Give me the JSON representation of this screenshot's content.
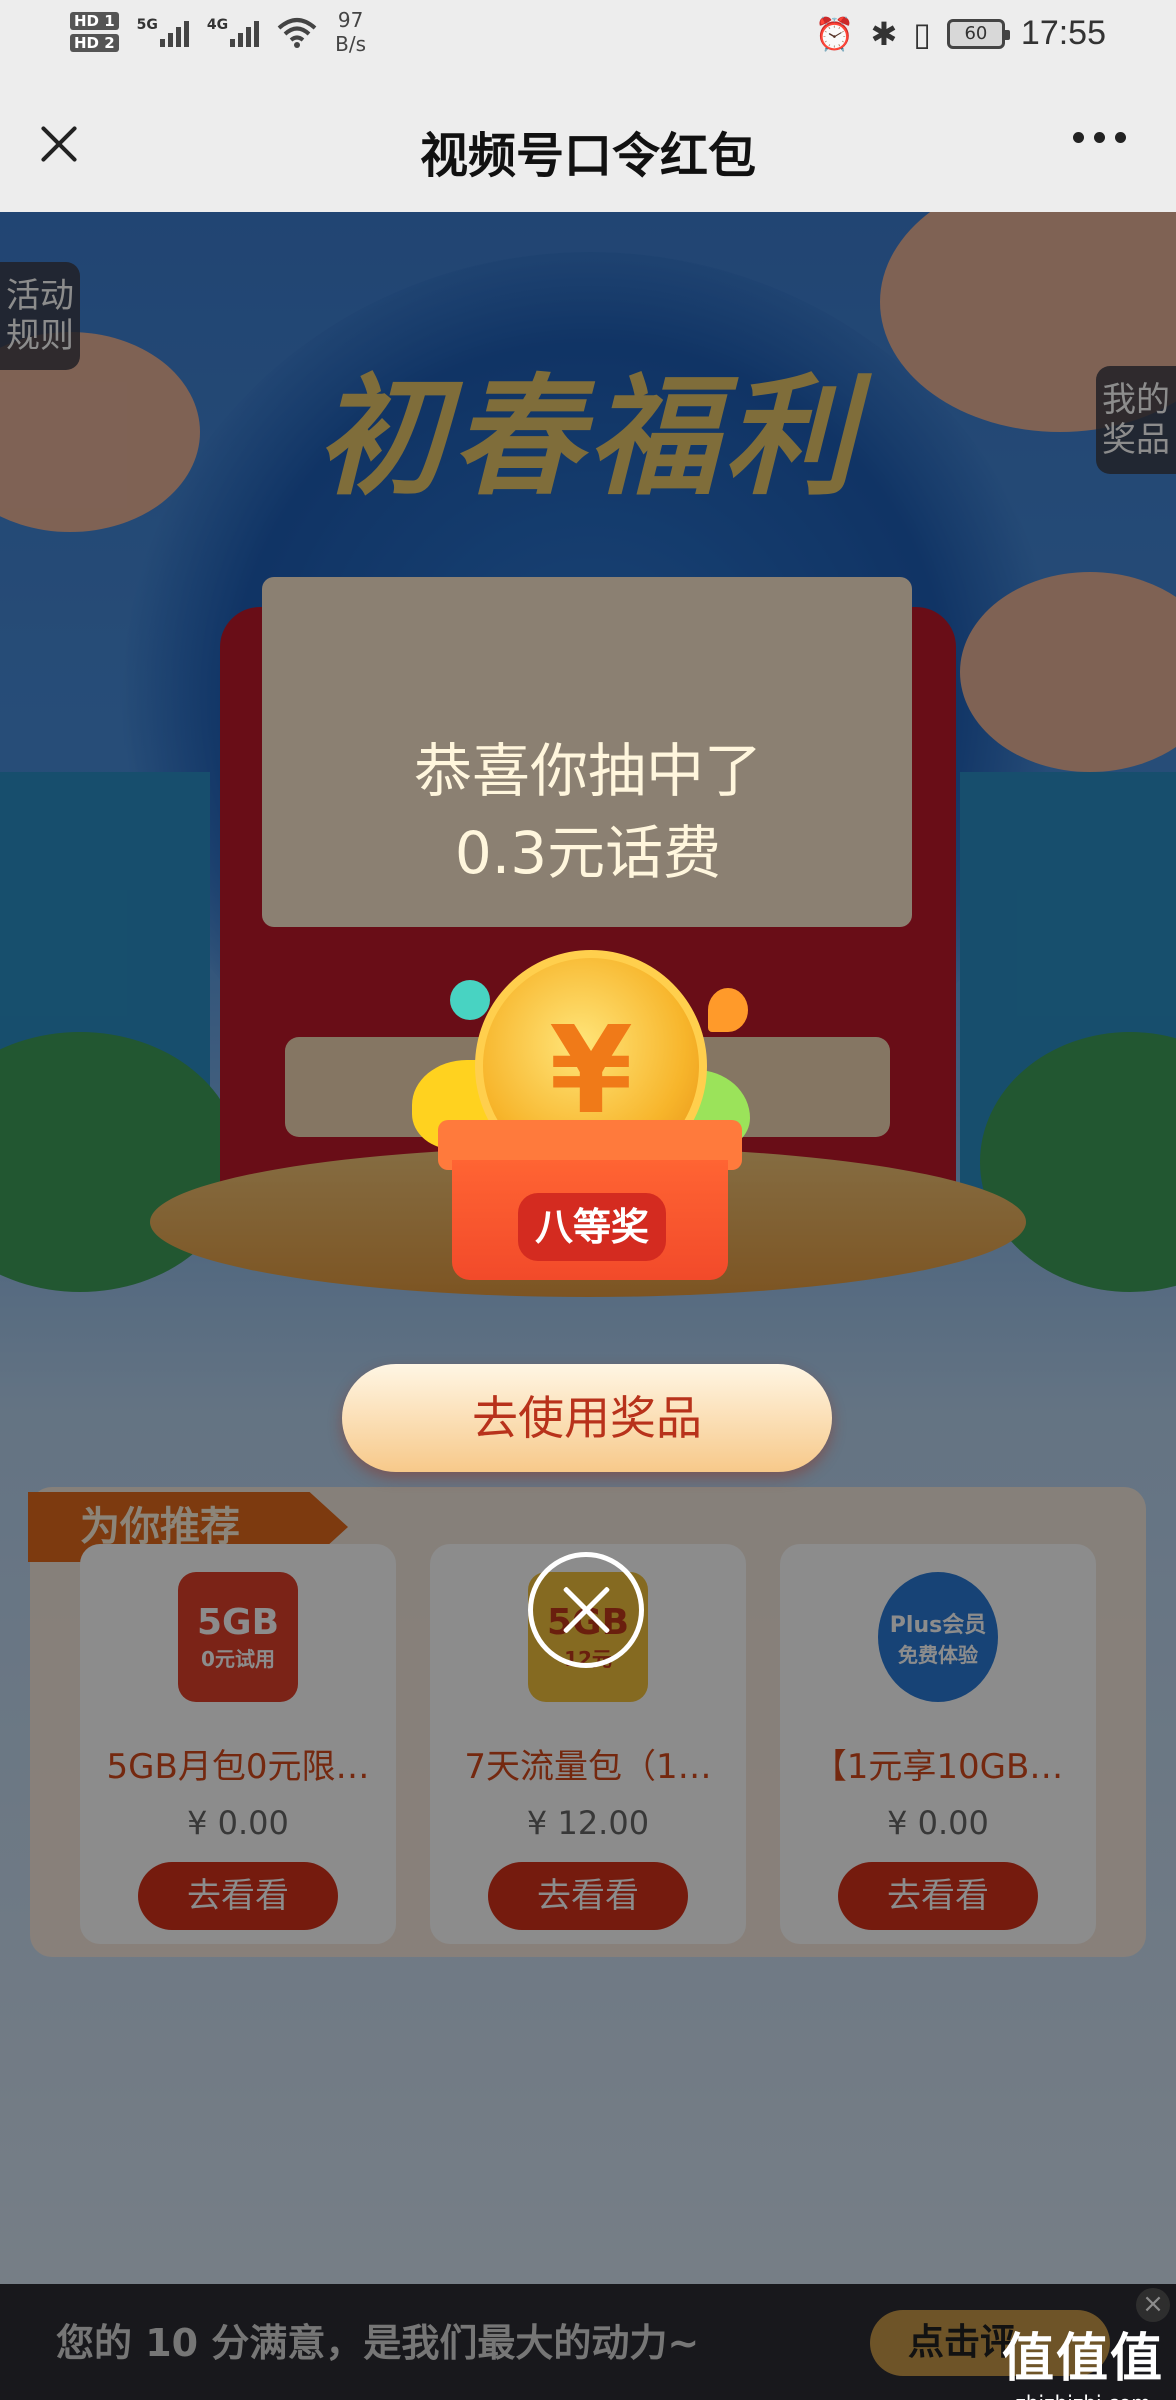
{
  "status_bar": {
    "hd1": "HD 1",
    "hd2": "HD 2",
    "net1": "5G",
    "net2": "4G",
    "speed_value": "97",
    "speed_unit": "B/s",
    "battery": "60",
    "time": "17:55",
    "icons": [
      "alarm-icon",
      "bluetooth-icon",
      "vibrate-icon",
      "battery-icon"
    ]
  },
  "titlebar": {
    "title": "视频号口令红包"
  },
  "page": {
    "headline": "初春福利",
    "rules_tab": "活动规则",
    "prizes_tab": "我的奖品"
  },
  "recommend": {
    "tag": "为你推荐",
    "items": [
      {
        "image_text": "5GB",
        "image_sub": "0元试用",
        "name": "5GB月包0元限…",
        "price": "¥ 0.00",
        "button": "去看看",
        "color": "#e0402a"
      },
      {
        "image_text": "5GB",
        "image_sub": "12元",
        "name": "7天流量包（1…",
        "price": "¥ 12.00",
        "button": "去看看",
        "color": "#f3c23c"
      },
      {
        "image_text": "Plus会员",
        "image_sub": "免费体验",
        "name": "【1元享10GB…",
        "price": "¥ 0.00",
        "button": "去看看",
        "color": "#2a7bd8"
      }
    ]
  },
  "bottom_bar": {
    "text": "您的 10 分满意，是我们最大的动力~",
    "button": "点击评"
  },
  "modal": {
    "line1": "恭喜你抽中了",
    "line2": "0.3元话费",
    "prize_level": "八等奖",
    "coin_symbol": "¥",
    "use_button": "去使用奖品"
  },
  "watermark": {
    "big": "值值值",
    "small": "zhizhizhi.com"
  }
}
